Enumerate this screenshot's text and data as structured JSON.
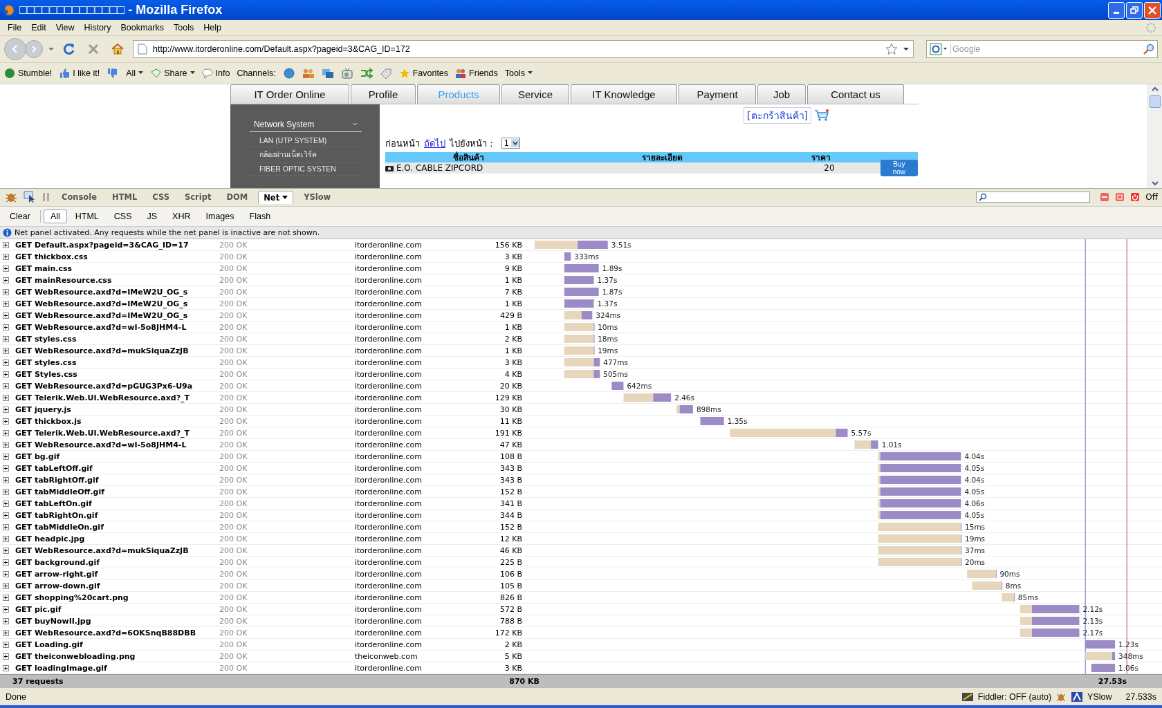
{
  "window": {
    "title": "□□□□□□□□□□□□□□ - Mozilla Firefox"
  },
  "menu": [
    "File",
    "Edit",
    "View",
    "History",
    "Bookmarks",
    "Tools",
    "Help"
  ],
  "address": {
    "value": "http://www.itorderonline.com/Default.aspx?pageid=3&CAG_ID=172"
  },
  "search": {
    "placeholder": "Google"
  },
  "bookmarks_bar": [
    {
      "kind": "icon-text",
      "label": "Stumble!"
    },
    {
      "kind": "icon-text",
      "label": "I like it!"
    },
    {
      "kind": "icon"
    },
    {
      "kind": "dropdown",
      "label": "All"
    },
    {
      "kind": "dropdown",
      "label": "Share"
    },
    {
      "kind": "icon-text",
      "label": "Info"
    },
    {
      "kind": "text",
      "label": "Channels:"
    },
    {
      "kind": "icon"
    },
    {
      "kind": "icon"
    },
    {
      "kind": "icon"
    },
    {
      "kind": "icon"
    },
    {
      "kind": "icon"
    },
    {
      "kind": "icon"
    },
    {
      "kind": "icon-text",
      "label": "Favorites"
    },
    {
      "kind": "icon-text",
      "label": "Friends"
    },
    {
      "kind": "dropdown",
      "label": "Tools"
    }
  ],
  "site": {
    "tabs": [
      {
        "label": "IT Order Online",
        "selected": false
      },
      {
        "label": "Profile",
        "selected": false
      },
      {
        "label": "Products",
        "selected": true
      },
      {
        "label": "Service",
        "selected": false
      },
      {
        "label": "IT Knowledge",
        "selected": false
      },
      {
        "label": "Payment",
        "selected": false
      },
      {
        "label": "Job",
        "selected": false
      },
      {
        "label": "Contact us",
        "selected": false
      }
    ],
    "sidebar": {
      "heading": "Network System",
      "items": [
        "LAN (UTP SYSTEM)",
        "กล้องผ่านเน็ตเวิร์ค",
        "FIBER OPTIC SYSTEN"
      ]
    },
    "cart_link": "[ตะกร้าสินค้า]",
    "pager": {
      "previous": "ก่อนหน้า",
      "next": "ถัดไป",
      "goto": "ไปยังหน้า :",
      "page": "1"
    },
    "table": {
      "columns": [
        "ชื่อสินค้า",
        "รายละเอียด",
        "ราคา"
      ],
      "rows": [
        {
          "name": "E.O. CABLE ZIPCORD",
          "price": "20",
          "button": "Buy now"
        }
      ]
    }
  },
  "firebug": {
    "tabs": [
      {
        "label": "Console",
        "selected": false
      },
      {
        "label": "HTML",
        "selected": false
      },
      {
        "label": "CSS",
        "selected": false
      },
      {
        "label": "Script",
        "selected": false
      },
      {
        "label": "DOM",
        "selected": false
      },
      {
        "label": "Net",
        "selected": true
      },
      {
        "label": "YSlow",
        "selected": false
      }
    ],
    "off_label": "Off",
    "clear": "Clear",
    "filters": [
      {
        "label": "All",
        "selected": true
      },
      {
        "label": "HTML",
        "selected": false
      },
      {
        "label": "CSS",
        "selected": false
      },
      {
        "label": "JS",
        "selected": false
      },
      {
        "label": "XHR",
        "selected": false
      },
      {
        "label": "Images",
        "selected": false
      },
      {
        "label": "Flash",
        "selected": false
      }
    ],
    "notice": "Net panel activated. Any requests while the net panel is inactive are not shown.",
    "requests": [
      {
        "url": "GET Default.aspx?pageid=3&CAG_ID=17",
        "status": "200 OK",
        "domain": "itorderonline.com",
        "size": "156 KB",
        "time": "3.51s"
      },
      {
        "url": "GET thickbox.css",
        "status": "200 OK",
        "domain": "itorderonline.com",
        "size": "3 KB",
        "time": "333ms"
      },
      {
        "url": "GET main.css",
        "status": "200 OK",
        "domain": "itorderonline.com",
        "size": "9 KB",
        "time": "1.89s"
      },
      {
        "url": "GET mainResource.css",
        "status": "200 OK",
        "domain": "itorderonline.com",
        "size": "1 KB",
        "time": "1.37s"
      },
      {
        "url": "GET WebResource.axd?d=IMeW2U_OG_s",
        "status": "200 OK",
        "domain": "itorderonline.com",
        "size": "7 KB",
        "time": "1.87s"
      },
      {
        "url": "GET WebResource.axd?d=IMeW2U_OG_s",
        "status": "200 OK",
        "domain": "itorderonline.com",
        "size": "1 KB",
        "time": "1.37s"
      },
      {
        "url": "GET WebResource.axd?d=IMeW2U_OG_s",
        "status": "200 OK",
        "domain": "itorderonline.com",
        "size": "429 B",
        "time": "324ms"
      },
      {
        "url": "GET WebResource.axd?d=wI-5o8JHM4-L",
        "status": "200 OK",
        "domain": "itorderonline.com",
        "size": "1 KB",
        "time": "10ms"
      },
      {
        "url": "GET styles.css",
        "status": "200 OK",
        "domain": "itorderonline.com",
        "size": "2 KB",
        "time": "18ms"
      },
      {
        "url": "GET WebResource.axd?d=mukSiquaZzJB",
        "status": "200 OK",
        "domain": "itorderonline.com",
        "size": "1 KB",
        "time": "19ms"
      },
      {
        "url": "GET styles.css",
        "status": "200 OK",
        "domain": "itorderonline.com",
        "size": "3 KB",
        "time": "477ms"
      },
      {
        "url": "GET Styles.css",
        "status": "200 OK",
        "domain": "itorderonline.com",
        "size": "4 KB",
        "time": "505ms"
      },
      {
        "url": "GET WebResource.axd?d=pGUG3Px6-U9a",
        "status": "200 OK",
        "domain": "itorderonline.com",
        "size": "20 KB",
        "time": "642ms"
      },
      {
        "url": "GET Telerik.Web.UI.WebResource.axd?_T",
        "status": "200 OK",
        "domain": "itorderonline.com",
        "size": "129 KB",
        "time": "2.46s"
      },
      {
        "url": "GET jquery.js",
        "status": "200 OK",
        "domain": "itorderonline.com",
        "size": "30 KB",
        "time": "898ms"
      },
      {
        "url": "GET thickbox.js",
        "status": "200 OK",
        "domain": "itorderonline.com",
        "size": "11 KB",
        "time": "1.35s"
      },
      {
        "url": "GET Telerik.Web.UI.WebResource.axd?_T",
        "status": "200 OK",
        "domain": "itorderonline.com",
        "size": "191 KB",
        "time": "5.57s"
      },
      {
        "url": "GET WebResource.axd?d=wI-5o8JHM4-L",
        "status": "200 OK",
        "domain": "itorderonline.com",
        "size": "47 KB",
        "time": "1.01s"
      },
      {
        "url": "GET bg.gif",
        "status": "200 OK",
        "domain": "itorderonline.com",
        "size": "108 B",
        "time": "4.04s"
      },
      {
        "url": "GET tabLeftOff.gif",
        "status": "200 OK",
        "domain": "itorderonline.com",
        "size": "343 B",
        "time": "4.05s"
      },
      {
        "url": "GET tabRightOff.gif",
        "status": "200 OK",
        "domain": "itorderonline.com",
        "size": "343 B",
        "time": "4.04s"
      },
      {
        "url": "GET tabMiddleOff.gif",
        "status": "200 OK",
        "domain": "itorderonline.com",
        "size": "152 B",
        "time": "4.05s"
      },
      {
        "url": "GET tabLeftOn.gif",
        "status": "200 OK",
        "domain": "itorderonline.com",
        "size": "341 B",
        "time": "4.06s"
      },
      {
        "url": "GET tabRightOn.gif",
        "status": "200 OK",
        "domain": "itorderonline.com",
        "size": "344 B",
        "time": "4.05s"
      },
      {
        "url": "GET tabMiddleOn.gif",
        "status": "200 OK",
        "domain": "itorderonline.com",
        "size": "152 B",
        "time": "15ms"
      },
      {
        "url": "GET headpic.jpg",
        "status": "200 OK",
        "domain": "itorderonline.com",
        "size": "12 KB",
        "time": "19ms"
      },
      {
        "url": "GET WebResource.axd?d=mukSiquaZzJB",
        "status": "200 OK",
        "domain": "itorderonline.com",
        "size": "46 KB",
        "time": "37ms"
      },
      {
        "url": "GET background.gif",
        "status": "200 OK",
        "domain": "itorderonline.com",
        "size": "225 B",
        "time": "20ms"
      },
      {
        "url": "GET arrow-right.gif",
        "status": "200 OK",
        "domain": "itorderonline.com",
        "size": "106 B",
        "time": "90ms"
      },
      {
        "url": "GET arrow-down.gif",
        "status": "200 OK",
        "domain": "itorderonline.com",
        "size": "105 B",
        "time": "8ms"
      },
      {
        "url": "GET shopping%20cart.png",
        "status": "200 OK",
        "domain": "itorderonline.com",
        "size": "826 B",
        "time": "85ms"
      },
      {
        "url": "GET pic.gif",
        "status": "200 OK",
        "domain": "itorderonline.com",
        "size": "572 B",
        "time": "2.12s"
      },
      {
        "url": "GET buyNowII.jpg",
        "status": "200 OK",
        "domain": "itorderonline.com",
        "size": "788 B",
        "time": "2.13s"
      },
      {
        "url": "GET WebResource.axd?d=6OKSnqB88DBB",
        "status": "200 OK",
        "domain": "itorderonline.com",
        "size": "172 KB",
        "time": "2.17s"
      },
      {
        "url": "GET Loading.gif",
        "status": "200 OK",
        "domain": "itorderonline.com",
        "size": "2 KB",
        "time": "1.23s"
      },
      {
        "url": "GET theiconwebloading.png",
        "status": "200 OK",
        "domain": "theiconweb.com",
        "size": "5 KB",
        "time": "348ms"
      },
      {
        "url": "GET loadingImage.gif",
        "status": "200 OK",
        "domain": "itorderonline.com",
        "size": "3 KB",
        "time": "1.06s"
      }
    ],
    "summary": {
      "count": "37 requests",
      "size": "870 KB",
      "time": "27.53s"
    }
  },
  "status_bar": {
    "text": "Done",
    "fiddler": "Fiddler: OFF (auto)",
    "yslow": "YSlow",
    "time": "27.533s"
  }
}
